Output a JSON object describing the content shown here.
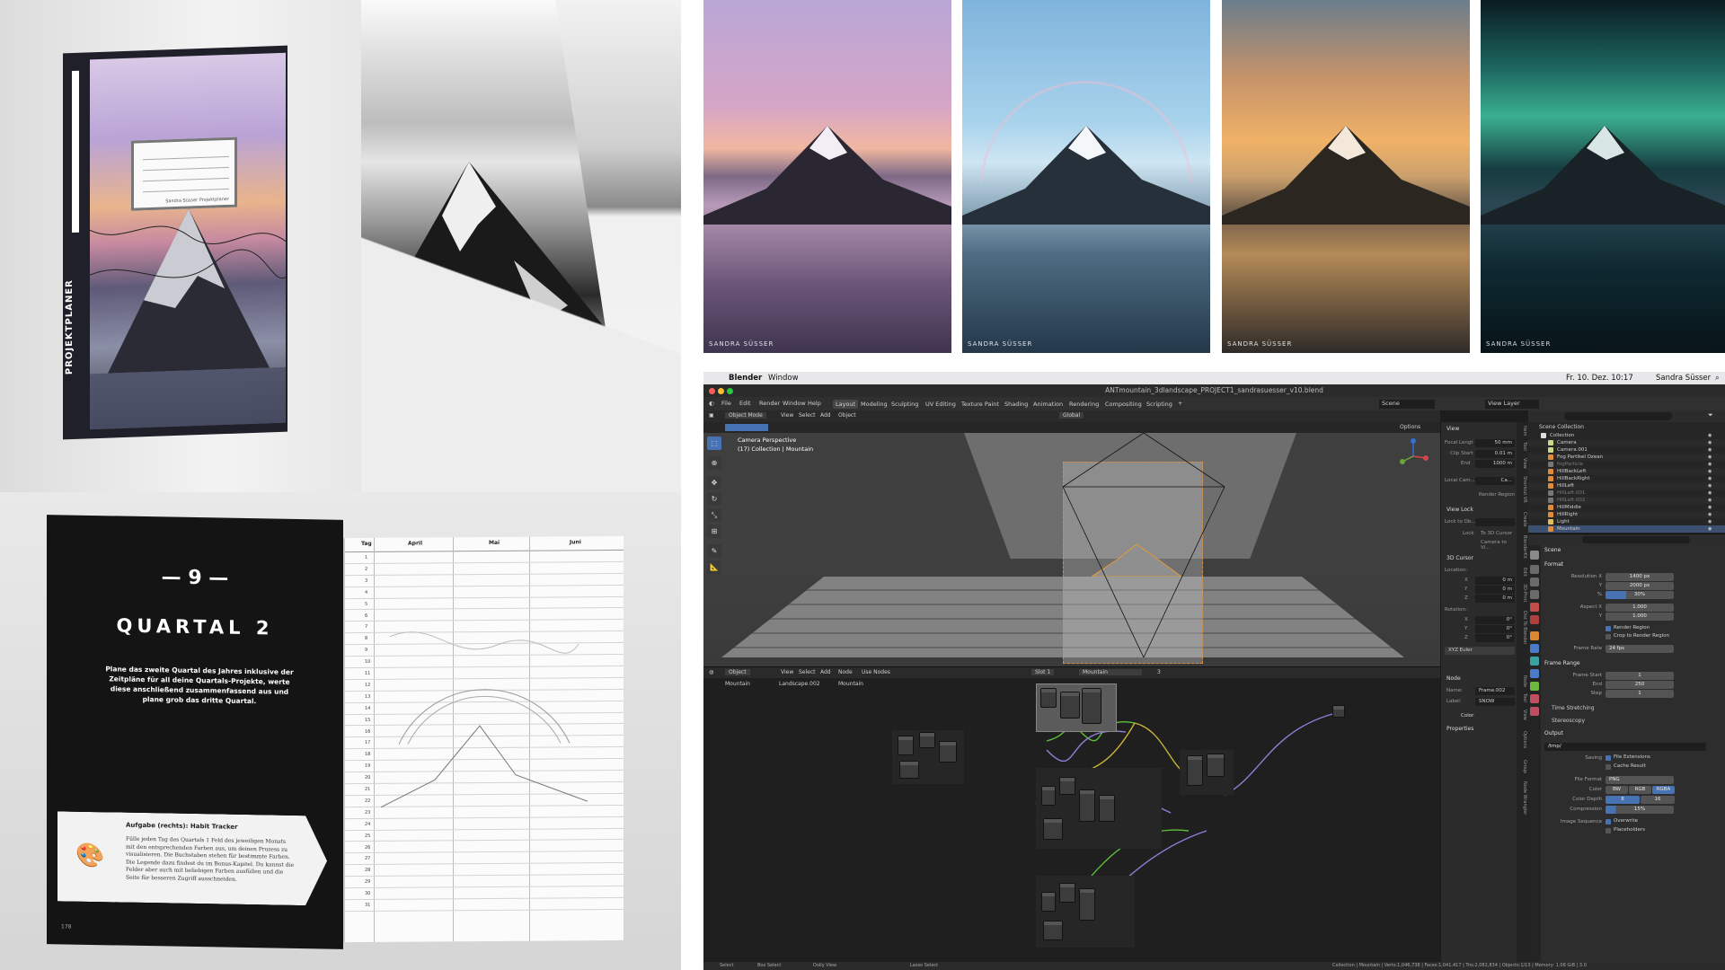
{
  "book": {
    "spine_title": "PROJEKTPLANER",
    "label_text": "Sandra Süsser Projektplaner"
  },
  "photos": [
    {
      "watermark": "SANDRA SÜSSER"
    },
    {
      "watermark": "SANDRA SÜSSER"
    },
    {
      "watermark": "SANDRA SÜSSER"
    },
    {
      "watermark": "SANDRA SÜSSER"
    }
  ],
  "open_book": {
    "number": "— 9 —",
    "title": "QUARTAL 2",
    "intro": "Plane das zweite Quartal des Jahres inklusive der Zeitpläne für all deine Quartals-Projekte, werte diese anschließend zusammenfassend aus und plane grob das dritte Quartal.",
    "task_title": "Aufgabe (rechts): Habit Tracker",
    "task_text": "Fülle jeden Tag des Quartals 1 Feld des jeweiligen Monats mit den entsprechenden Farben aus, um deinen Prozess zu visualisieren. Die Buchstaben stehen für bestimmte Farben. Die Legende dazu findest du im Bonus-Kapitel. Du kannst die Felder aber auch mit beliebigen Farben ausfüllen und die Seite für besseren Zugriff ausschneiden.",
    "page_number": "178",
    "calendar_headers": [
      "Tag",
      "April",
      "Mai",
      "Juni"
    ],
    "days": [
      "1",
      "2",
      "3",
      "4",
      "5",
      "6",
      "7",
      "8",
      "9",
      "10",
      "11",
      "12",
      "13",
      "14",
      "15",
      "16",
      "17",
      "18",
      "19",
      "20",
      "21",
      "22",
      "23",
      "24",
      "25",
      "26",
      "27",
      "28",
      "29",
      "30",
      "31"
    ]
  },
  "mac_menubar": {
    "app": "Blender",
    "menu": "Window",
    "datetime": "Fr. 10. Dez. 10:17",
    "user": "Sandra Süsser"
  },
  "blender": {
    "file_title": "ANTmountain_3dlandscape_PROJECT1_sandrasuesser_v10.blend",
    "menus": [
      "File",
      "Edit",
      "Render",
      "Window",
      "Help"
    ],
    "workspaces": [
      "Layout",
      "Modeling",
      "Sculpting",
      "UV Editing",
      "Texture Paint",
      "Shading",
      "Animation",
      "Rendering",
      "Compositing",
      "Scripting"
    ],
    "active_workspace": "Layout",
    "scene": "Scene",
    "view_layer": "View Layer",
    "viewport": {
      "mode": "Object Mode",
      "menus": [
        "View",
        "Select",
        "Add",
        "Object"
      ],
      "orientation": "Global",
      "options": "Options",
      "overlay_line1": "Camera Perspective",
      "overlay_line2": "(17) Collection | Mountain"
    },
    "npanel": {
      "view_header": "View",
      "focal_length_label": "Focal Lengt",
      "focal_length": "50 mm",
      "clip_start_label": "Clip Start",
      "clip_start": "0.01 m",
      "end_label": "End",
      "end": "1000 m",
      "local_camera": "Local Cam...",
      "local_camera_value": "Ca...",
      "render_region": "Render Region",
      "view_lock": "View Lock",
      "lock_to_object": "Lock to Ob...",
      "lock": "Lock",
      "to_3d_cursor": "To 3D Cursor",
      "camera_to_view": "Camera to Vi...",
      "cursor_header": "3D Cursor",
      "location": "Location:",
      "rotation": "Rotation:",
      "x": "X",
      "y": "Y",
      "z": "Z",
      "loc_value": "0 m",
      "rot_value": "0°",
      "euler": "XYZ Euler",
      "tabs": [
        "Item",
        "Tool",
        "View",
        "Shortcut VR",
        "Create",
        "BlenderKit",
        "Edit",
        "3D-Print",
        "Dist To Blender"
      ]
    },
    "node_editor": {
      "type": "Object",
      "menus": [
        "View",
        "Select",
        "Add",
        "Node"
      ],
      "use_nodes": "Use Nodes",
      "slot": "Slot 1",
      "material": "Mountain",
      "users": "3",
      "breadcrumb": [
        "Mountain",
        "Landscape.002",
        "Mountain"
      ],
      "side": {
        "node_header": "Node",
        "name_label": "Name:",
        "name": "Frame.002",
        "label_label": "Label:",
        "label": "SNOW",
        "color": "Color",
        "properties": "Properties"
      },
      "tabs": [
        "Node",
        "Tool",
        "View",
        "Options",
        "Group",
        "Node Wrangler"
      ]
    },
    "outliner": {
      "search_placeholder": "",
      "scene_collection": "Scene Collection",
      "items": [
        "Collection",
        "Camera",
        "Camera.001",
        "Fog Partikel Ozean",
        "fogParticle",
        "HillBackLeft",
        "HillBackRight",
        "HillLeft",
        "HillLeft.001",
        "HillLeft.002",
        "HillMiddle",
        "HillRight",
        "Light",
        "Mountain"
      ]
    },
    "properties": {
      "context": "Scene",
      "format": "Format",
      "resolution_x_label": "Resolution X",
      "resolution_x": "1400 px",
      "y_label": "Y",
      "resolution_y": "2000 px",
      "percent_label": "%",
      "percent": "30%",
      "aspect_x_label": "Aspect X",
      "aspect_x": "1.000",
      "aspect_y": "1.000",
      "render_region": "Render Region",
      "crop": "Crop to Render Region",
      "frame_rate_label": "Frame Rate",
      "frame_rate": "24 fps",
      "frame_range": "Frame Range",
      "frame_start_label": "Frame Start",
      "frame_start": "1",
      "end_label": "End",
      "frame_end": "250",
      "step_label": "Step",
      "step": "1",
      "time_stretching": "Time Stretching",
      "stereoscopy": "Stereoscopy",
      "output": "Output",
      "path": "/tmp/",
      "saving_label": "Saving",
      "file_extensions": "File Extensions",
      "cache_result": "Cache Result",
      "file_format_label": "File Format",
      "file_format": "PNG",
      "color_label": "Color",
      "color_modes": [
        "BW",
        "RGB",
        "RGBA"
      ],
      "color_depth_label": "Color Depth",
      "color_depths": [
        "8",
        "16"
      ],
      "compression_label": "Compression",
      "compression": "15%",
      "image_sequence_label": "Image Sequence",
      "overwrite": "Overwrite",
      "placeholders": "Placeholders"
    },
    "status_bar": {
      "select": "Select",
      "box_select": "Box Select",
      "dolly": "Dolly View",
      "lasso": "Lasso Select",
      "stats": "Collection | Mountain | Verts:1,046,738 | Faces:1,041,417 | Tris:2,082,834 | Objects:1/13 | Memory: 1.08 GiB | 3.0"
    }
  }
}
